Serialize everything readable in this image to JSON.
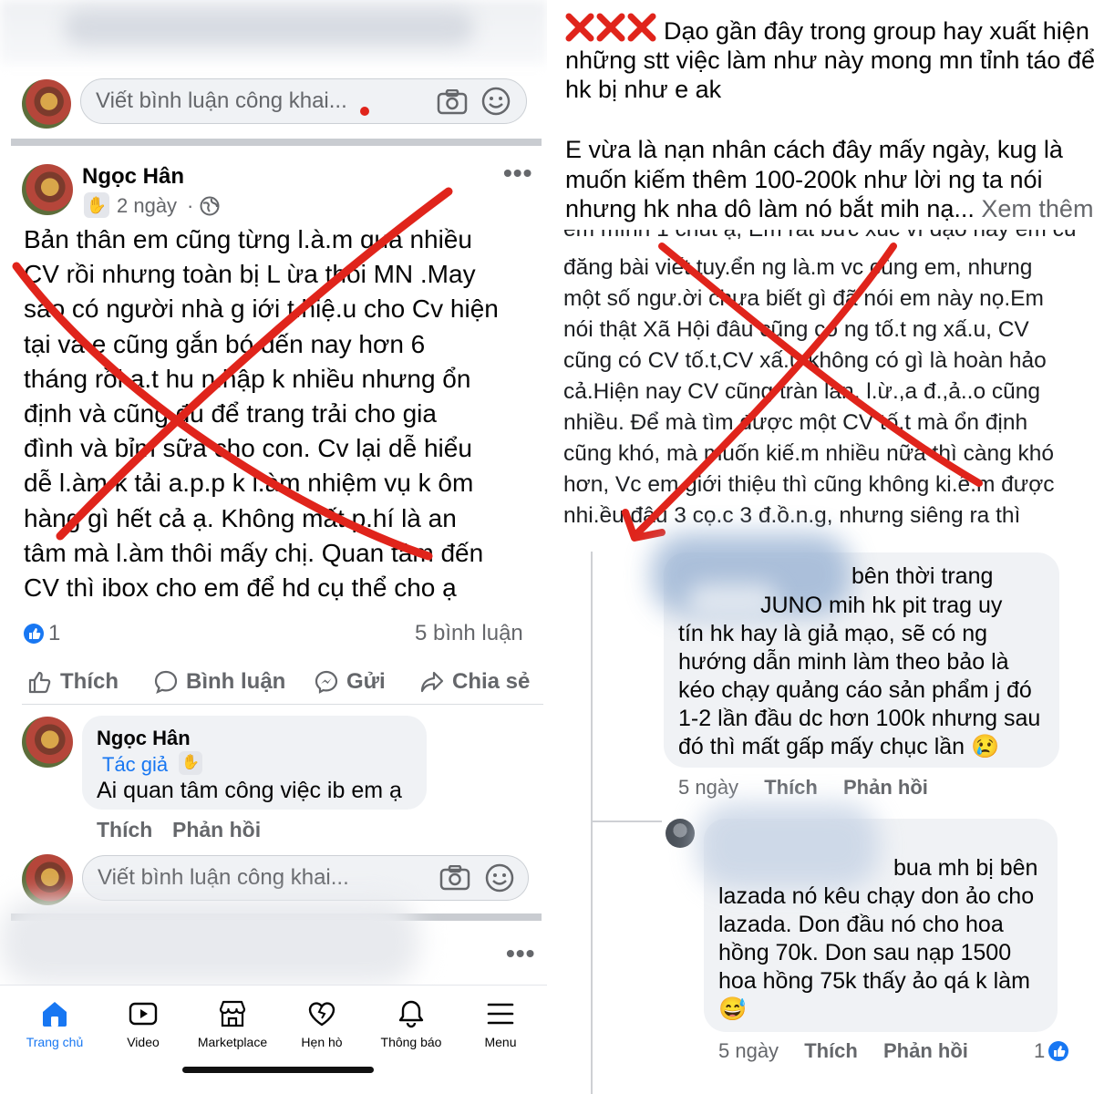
{
  "left": {
    "top_comment_placeholder": "Viết bình luận công khai...",
    "post": {
      "author": "Ngọc Hân",
      "time": "2 ngày",
      "text": "Bản thân em cũng từng l.à.m qua nhiều\nCV rồi nhưng toàn bị L ừa thôi MN .May\nsao có người nhà g iới t.hiệ.u cho Cv hiện\ntại và e cũng gắn bó đến nay hơn 6\ntháng rồi ạ.t hu n.hập k nhiều nhưng ổn\nđịnh và cũng đủ để trang trải cho gia\nđình và bỉm sữa cho con. Cv lại dễ hiểu\ndễ l.àm k tải a.p.p k l.àm nhiệm vụ k ôm\nhàng gì hết cả ạ. Không mất p.hí là an\ntâm mà l.àm thôi mấy chị. Quan tâm đến\nCV thì ibox cho em để hd cụ thể cho ạ",
      "like_count": "1",
      "comment_count": "5 bình luận",
      "actions": {
        "like": "Thích",
        "comment": "Bình luận",
        "send": "Gửi",
        "share": "Chia sẻ"
      }
    },
    "reply": {
      "author": "Ngọc Hân",
      "author_badge": "Tác giả",
      "text": "Ai quan tâm công việc ib em ạ",
      "like": "Thích",
      "reply": "Phản hồi"
    },
    "bottom_comment_placeholder": "Viết bình luận công khai...",
    "nav": [
      {
        "label": "Trang chủ",
        "icon": "home-icon"
      },
      {
        "label": "Video",
        "icon": "video-icon"
      },
      {
        "label": "Marketplace",
        "icon": "marketplace-icon"
      },
      {
        "label": "Hẹn hò",
        "icon": "dating-heart-icon"
      },
      {
        "label": "Thông báo",
        "icon": "bell-icon"
      },
      {
        "label": "Menu",
        "icon": "menu-icon"
      }
    ],
    "colors": {
      "accent": "#1877f2",
      "warning_red": "#e0241b"
    }
  },
  "right": {
    "post_text_line1": "Dạo gần đây trong group hay xuất hiện",
    "post_text_line2": "những stt việc làm như này mong mn tỉnh táo để",
    "post_text_line3": "hk bị như e ak",
    "post_text_para2_line1": "E vừa là nạn nhân cách đây mấy ngày, kug là",
    "post_text_para2_line2": "muốn kiếm thêm 100-200k như lời ng ta nói",
    "post_text_para2_line3": "nhưng hk nha dô làm nó bắt mih nạ...",
    "see_more": "Xem thêm",
    "screenshot_lines": [
      "em mình 1 chút ạ, Em rất bức xúc vì dạo nay em cứ",
      "đăng bài viết tuy.ển ng là.m vc cùng em, nhưng",
      "một số ngư.ời chưa biết gì đã nói em này nọ.Em",
      "nói thật Xã Hội đâu cũng có ng tố.t ng xấ.u, CV",
      "cũng có CV tố.t,CV xấ.u không có gì là hoàn hảo",
      "cả.Hiện nay CV cũng tràn lan, l.ừ.,a đ.,ả..o cũng",
      "nhiều. Để mà tìm được một CV tố.t mà ổn định",
      "cũng khó, mà muốn kiế.m nhiều nữa thì càng khó",
      "hơn, Vc em giới thiệu thì cũng không ki.ế.m được",
      "nhi.ều đâu 3 cọ.c 3 đ.ồ.n.g, nhưng siêng ra thì"
    ],
    "comment1": {
      "lines": [
        "bên thời trang",
        "JUNO mih hk pit trag uy",
        "tín hk hay là giả mạo, sẽ có ng",
        "hướng dẫn minh làm theo bảo là",
        "kéo chạy quảng cáo sản phẩm j đó",
        "1-2 lần đầu dc hơn 100k nhưng sau",
        "đó thì mất gấp mấy chục lần 😢"
      ],
      "time": "5 ngày",
      "like": "Thích",
      "reply": "Phản hồi"
    },
    "comment2": {
      "lines": [
        "bua mh bị bên",
        "lazada nó kêu chạy don ảo cho",
        "lazada. Don đầu nó cho hoa",
        "hồng 70k. Don sau nạp 1500",
        "hoa hồng 75k thấy ảo qá k làm",
        "😅"
      ],
      "time": "5 ngày",
      "like": "Thích",
      "reply": "Phản hồi",
      "reaction_count": "1"
    }
  }
}
